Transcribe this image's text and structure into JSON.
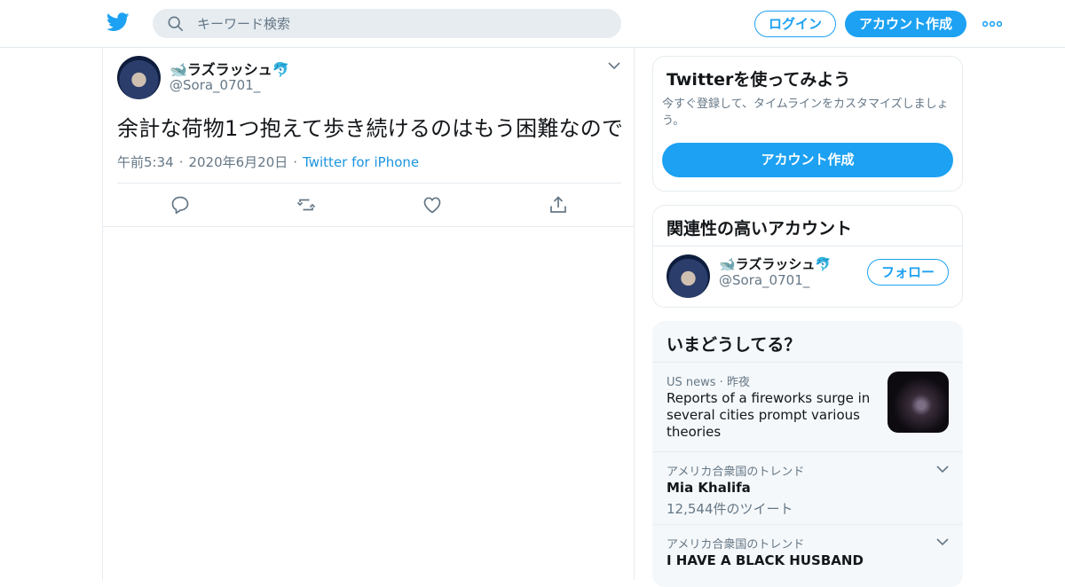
{
  "header": {
    "search_placeholder": "キーワード検索",
    "login_label": "ログイン",
    "signup_label": "アカウント作成"
  },
  "colors": {
    "accent": "#1da1f2",
    "secondary_text": "#657786",
    "link": "#1b95e0"
  },
  "tweet": {
    "display_name": "🐋ラズラッシュ🐬",
    "handle": "@Sora_0701_",
    "text": "余計な荷物1つ抱えて歩き続けるのはもう困難なので",
    "time": "午前5:34",
    "date": "2020年6月20日",
    "source": "Twitter for iPhone",
    "dot": "·",
    "actions": [
      "reply-icon",
      "retweet-icon",
      "like-icon",
      "share-icon"
    ]
  },
  "signup_card": {
    "title": "Twitterを使ってみよう",
    "subtitle": "今すぐ登録して、タイムラインをカスタマイズしましょう。",
    "button": "アカウント作成"
  },
  "related_card": {
    "title": "関連性の高いアカウント",
    "account": {
      "name": "🐋ラズラッシュ🐬",
      "handle": "@Sora_0701_",
      "follow_label": "フォロー"
    }
  },
  "trends_card": {
    "title": "いまどうしてる？",
    "items": [
      {
        "category": "US news · 昨夜",
        "title": "Reports of a fireworks surge in several cities prompt various theories"
      },
      {
        "category": "アメリカ合衆国のトレンド",
        "title": "Mia Khalifa",
        "count": "12,544件のツイート"
      },
      {
        "category": "アメリカ合衆国のトレンド",
        "title": "I HAVE A BLACK HUSBAND"
      }
    ]
  }
}
